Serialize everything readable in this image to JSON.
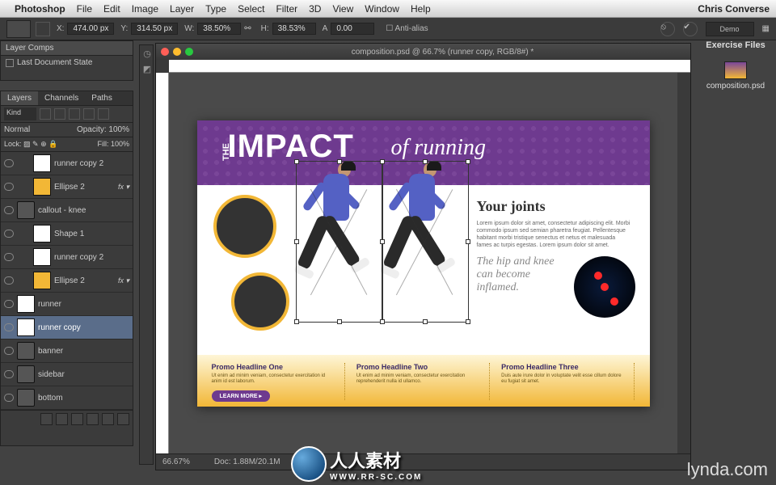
{
  "menubar": {
    "app": "Photoshop",
    "items": [
      "File",
      "Edit",
      "Image",
      "Layer",
      "Type",
      "Select",
      "Filter",
      "3D",
      "View",
      "Window",
      "Help"
    ],
    "user": "Chris Converse"
  },
  "optionsbar": {
    "x_label": "X:",
    "x": "474.00 px",
    "y_label": "Y:",
    "y": "314.50 px",
    "w_label": "W:",
    "w": "38.50%",
    "h_label": "H:",
    "h": "38.53%",
    "a_label": "A",
    "a": "0.00",
    "antialias": "Anti-alias",
    "demo": "Demo"
  },
  "layerComps": {
    "tab": "Layer Comps",
    "state": "Last Document State"
  },
  "layersPanel": {
    "tabs": [
      "Layers",
      "Channels",
      "Paths"
    ],
    "kind": "Kind",
    "mode": "Normal",
    "opacity_lbl": "Opacity:",
    "opacity": "100%",
    "lock_lbl": "Lock:",
    "fill_lbl": "Fill:",
    "fill": "100%",
    "rows": [
      {
        "name": "runner copy 2",
        "thumb": "w",
        "indent": 2,
        "fx": false
      },
      {
        "name": "Ellipse 2",
        "thumb": "y",
        "indent": 2,
        "fx": true
      },
      {
        "name": "callout - knee",
        "thumb": "folder",
        "indent": 0,
        "fx": false
      },
      {
        "name": "Shape 1",
        "thumb": "w",
        "indent": 2,
        "fx": false
      },
      {
        "name": "runner copy 2",
        "thumb": "w",
        "indent": 2,
        "fx": false
      },
      {
        "name": "Ellipse 2",
        "thumb": "y",
        "indent": 2,
        "fx": true
      },
      {
        "name": "runner",
        "thumb": "w",
        "indent": 0,
        "fx": false
      },
      {
        "name": "runner copy",
        "thumb": "w",
        "indent": 0,
        "fx": false,
        "sel": true
      },
      {
        "name": "banner",
        "thumb": "folder",
        "indent": 0,
        "fx": false
      },
      {
        "name": "sidebar",
        "thumb": "folder",
        "indent": 0,
        "fx": false
      },
      {
        "name": "bottom",
        "thumb": "folder",
        "indent": 0,
        "fx": false
      }
    ]
  },
  "document": {
    "title": "composition.psd @ 66.7% (runner copy, RGB/8#) *",
    "zoom": "66.67%",
    "docinfo": "Doc: 1.88M/20.1M"
  },
  "artboard": {
    "banner": {
      "the": "THE",
      "impact": "IMPACT",
      "ofrunning": "of running"
    },
    "right": {
      "h": "Your joints",
      "p": "Lorem ipsum dolor sit amet, consectetur adipiscing elit. Morbi commodo ipsum sed semian pharetra feugiat. Pellentesque habitant morbi tristique senectus et netus et malesuada fames ac turpis egestas. Lorem ipsum dolor sit amet.",
      "quote": "The hip and knee can become inflamed."
    },
    "promos": [
      {
        "h": "Promo Headline One",
        "p": "Ut enim ad minim veniam, consectetur exercitation id anim id est laborum."
      },
      {
        "h": "Promo Headline Two",
        "p": "Ut enim ad minim veniam, consectetur exercitation reprehenderit nulla id ullamco."
      },
      {
        "h": "Promo Headline Three",
        "p": "Duis aute irure dolor in voluptate velit esse cillum dolore eu fugiat sit amet."
      }
    ],
    "learnmore": "LEARN MORE ▸"
  },
  "desktop": {
    "heading": "Exercise Files",
    "file": "composition.psd"
  },
  "watermark": {
    "main": "人人素材",
    "sub": "WWW.RR-SC.COM",
    "brand": "lynda.com"
  }
}
